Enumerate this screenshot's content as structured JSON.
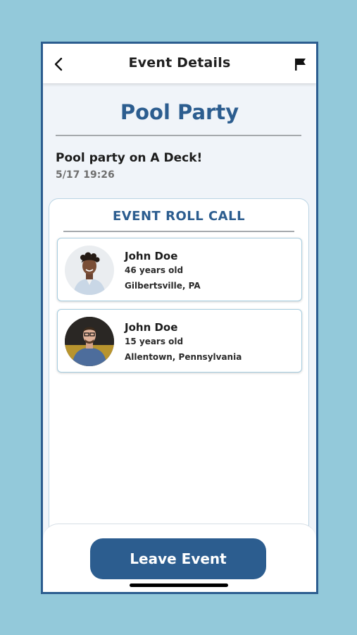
{
  "header": {
    "title": "Event Details",
    "back_icon": "chevron-left-icon",
    "flag_icon": "flag-icon"
  },
  "event": {
    "title": "Pool Party",
    "description": "Pool party on A Deck!",
    "datetime": "5/17 19:26"
  },
  "rollcall": {
    "title": "EVENT ROLL CALL",
    "people": [
      {
        "name": "John Doe",
        "age": "46 years old",
        "location": "Gilbertsville, PA"
      },
      {
        "name": "John Doe",
        "age": "15 years old",
        "location": "Allentown, Pennsylvania"
      }
    ]
  },
  "footer": {
    "leave_label": "Leave Event"
  },
  "colors": {
    "background": "#93c9da",
    "accent": "#2c5d8f",
    "screen": "#f0f4f9"
  }
}
